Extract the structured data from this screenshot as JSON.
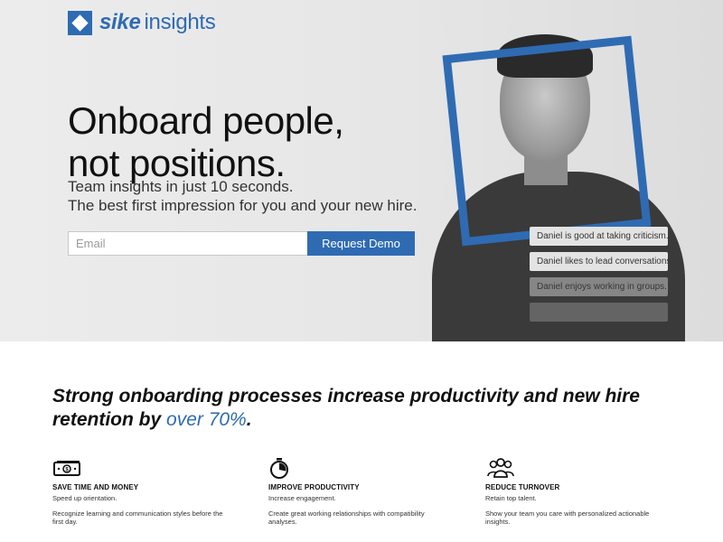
{
  "logo": {
    "brand_bold": "sike",
    "brand_light": "insights"
  },
  "hero": {
    "headline_line1": "Onboard people,",
    "headline_line2": "not positions.",
    "sub_line1": "Team insights in just 10 seconds.",
    "sub_line2": "The best first impression for you and your new hire."
  },
  "form": {
    "email_placeholder": "Email",
    "cta_label": "Request Demo"
  },
  "insights": [
    "Daniel is good at taking criticism.",
    "Daniel likes to lead conversations.",
    "Daniel enjoys working in groups.",
    ""
  ],
  "tagline": {
    "text": "Strong onboarding processes increase productivity and new hire retention by ",
    "highlight": "over 70%",
    "end": "."
  },
  "features": [
    {
      "icon": "money-icon",
      "title": "SAVE TIME AND MONEY",
      "line1": "Speed up orientation.",
      "line2": "Recognize learning and communication styles before the first day."
    },
    {
      "icon": "stopwatch-icon",
      "title": "IMPROVE PRODUCTIVITY",
      "line1": "Increase engagement.",
      "line2": "Create great working relationships with compatibility analyses."
    },
    {
      "icon": "team-icon",
      "title": "REDUCE TURNOVER",
      "line1": "Retain top talent.",
      "line2": "Show your team you care with personalized actionable insights."
    }
  ],
  "colors": {
    "brand_blue": "#2f6bb3",
    "hero_bg": "#e6e6e6"
  }
}
